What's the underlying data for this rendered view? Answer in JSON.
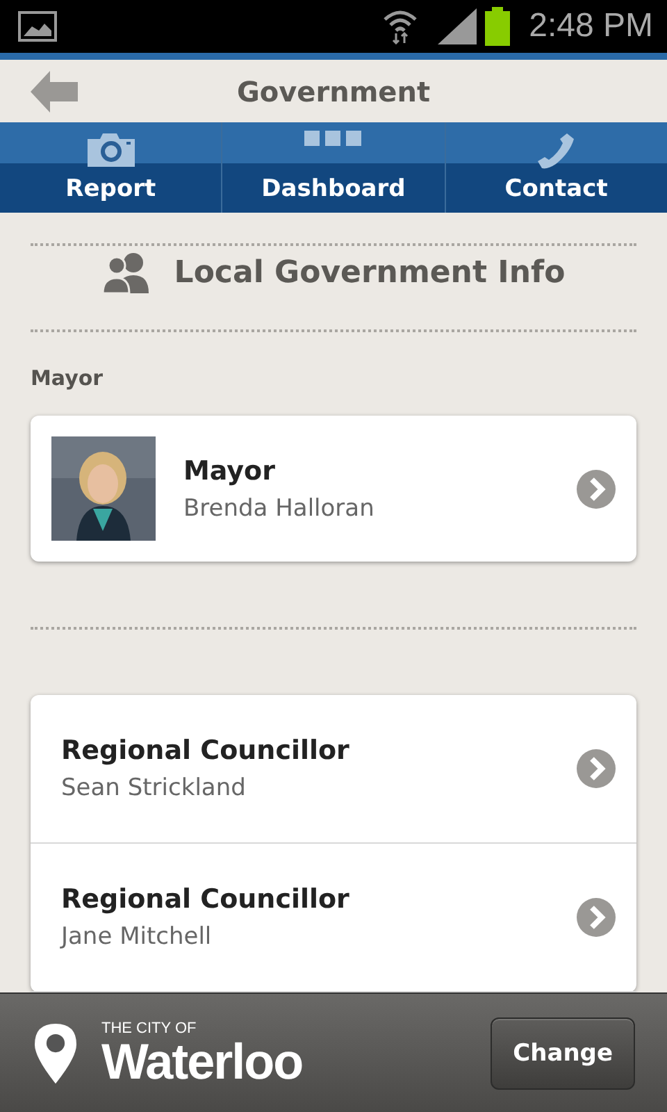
{
  "status_bar": {
    "time": "2:48 PM"
  },
  "header": {
    "title": "Government"
  },
  "tabs": [
    {
      "label": "Report",
      "kind": "camera"
    },
    {
      "label": "Dashboard",
      "kind": "grid"
    },
    {
      "label": "Contact",
      "kind": "phone"
    }
  ],
  "section_title": "Local Government Info",
  "mayor_section": {
    "label": "Mayor",
    "card": {
      "kind": "picture",
      "role": "Mayor",
      "name": "Brenda Halloran"
    }
  },
  "councillors": [
    {
      "role": "Regional Councillor",
      "name": "Sean Strickland"
    },
    {
      "role": "Regional Councillor",
      "name": "Jane Mitchell"
    }
  ],
  "footer": {
    "city_prefix": "THE CITY OF",
    "city_name": "Waterloo",
    "button": "Change"
  }
}
